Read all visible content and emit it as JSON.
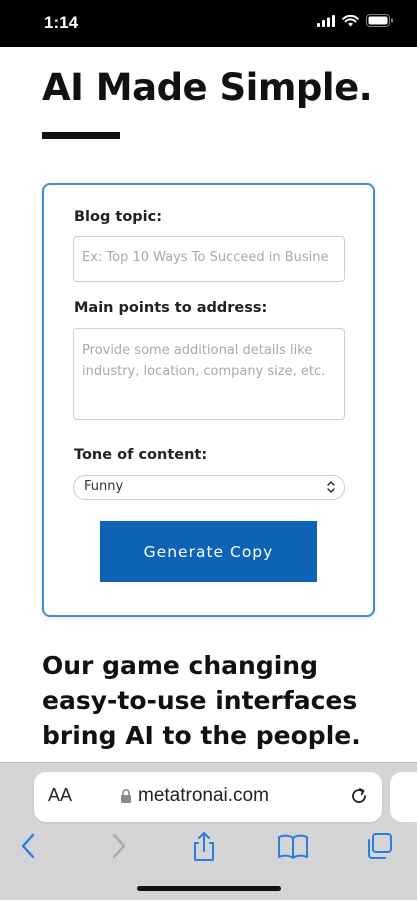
{
  "status_bar": {
    "time": "1:14"
  },
  "hero": {
    "title": "AI Made Simple."
  },
  "form": {
    "blog_topic_label": "Blog topic:",
    "blog_topic_placeholder": "Ex: Top 10 Ways To Succeed in Busine",
    "main_points_label": "Main points to address:",
    "main_points_placeholder": "Provide some additional details like industry, location, company size, etc.",
    "tone_label": "Tone of content:",
    "tone_selected": "Funny",
    "generate_label": "Generate Copy"
  },
  "tagline": "Our game changing easy-to-use interfaces bring AI to the people.",
  "browser": {
    "text_size_label": "AA",
    "url": "metatronai.com"
  },
  "colors": {
    "accent": "#0e63b6",
    "card_border": "#3a8fd8",
    "toolbar_icon": "#2a7de1"
  }
}
